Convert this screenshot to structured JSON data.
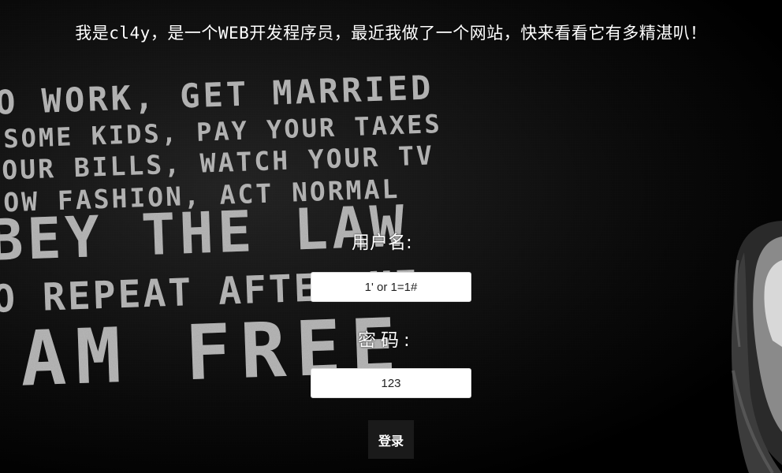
{
  "page": {
    "headline": "我是cl4y，是一个WEB开发程序员，最近我做了一个网站，快来看看它有多精湛叭！"
  },
  "background": {
    "poster_lines": [
      "O WORK, GET MARRIED",
      "SOME KIDS, PAY YOUR TAXES",
      "OUR BILLS, WATCH YOUR TV",
      "OW FASHION, ACT NORMAL",
      "BEY THE LAW",
      "O REPEAT AFTER ME:",
      "AM FREE"
    ]
  },
  "login_form": {
    "username_label": "用户名:",
    "username_value": "1' or 1=1#",
    "password_label": "密码:",
    "password_value": "123",
    "submit_label": "登录"
  },
  "colors": {
    "background": "#050505",
    "text": "#ffffff",
    "poster_text": "#bdbdbd",
    "button": "#1a1a1a"
  }
}
